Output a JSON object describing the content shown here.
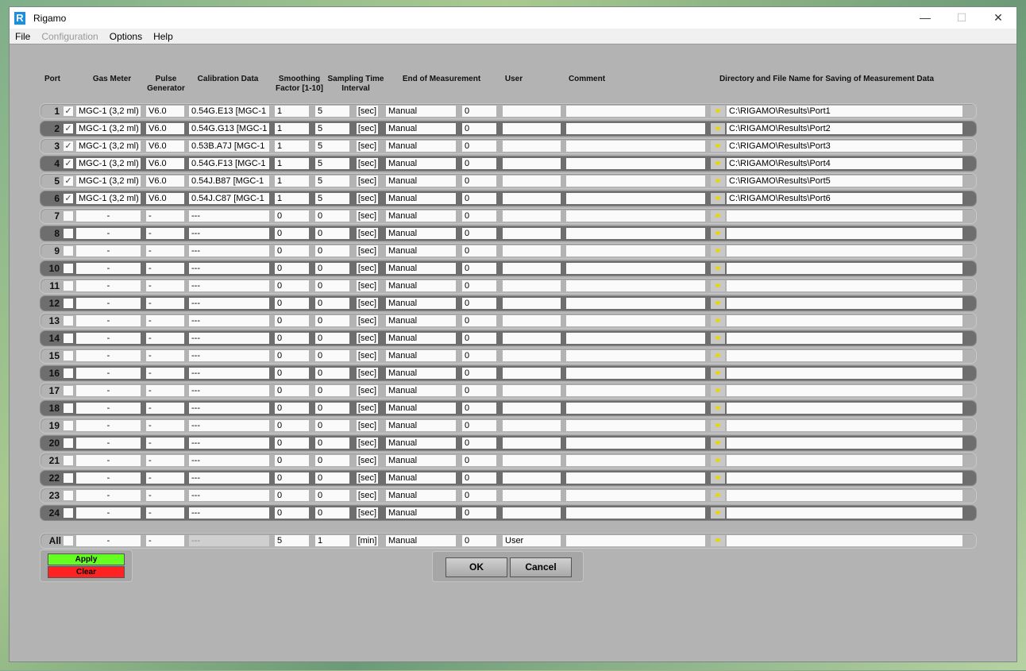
{
  "window": {
    "title": "Rigamo",
    "minimize": "—",
    "maximize": "☐",
    "close": "✕"
  },
  "menu": [
    "File",
    "Configuration",
    "Options",
    "Help"
  ],
  "headers": {
    "port": "Port",
    "gas_meter": "Gas Meter",
    "pulse": "Pulse Generator",
    "calibration": "Calibration Data",
    "smoothing": "Smoothing Factor [1-10]",
    "sampling": "Sampling Time Interval",
    "end": "End of Measurement",
    "user": "User",
    "comment": "Comment",
    "directory": "Directory and File Name for Saving of Measurement Data"
  },
  "rows": [
    {
      "port": "1",
      "checked": true,
      "gas": "MGC-1 (3,2 ml)",
      "pulse": "V6.0",
      "cal": "0.54G.E13 [MGC-1",
      "smooth": "1",
      "sample": "5",
      "unit": "[sec]",
      "end": "Manual",
      "end_val": "0",
      "user": "",
      "comment": "",
      "dir": "C:\\RIGAMO\\Results\\Port1"
    },
    {
      "port": "2",
      "checked": true,
      "gas": "MGC-1 (3,2 ml)",
      "pulse": "V6.0",
      "cal": "0.54G.G13 [MGC-1",
      "smooth": "1",
      "sample": "5",
      "unit": "[sec]",
      "end": "Manual",
      "end_val": "0",
      "user": "",
      "comment": "",
      "dir": "C:\\RIGAMO\\Results\\Port2"
    },
    {
      "port": "3",
      "checked": true,
      "gas": "MGC-1 (3,2 ml)",
      "pulse": "V6.0",
      "cal": "0.53B.A7J [MGC-1",
      "smooth": "1",
      "sample": "5",
      "unit": "[sec]",
      "end": "Manual",
      "end_val": "0",
      "user": "",
      "comment": "",
      "dir": "C:\\RIGAMO\\Results\\Port3"
    },
    {
      "port": "4",
      "checked": true,
      "gas": "MGC-1 (3,2 ml)",
      "pulse": "V6.0",
      "cal": "0.54G.F13 [MGC-1",
      "smooth": "1",
      "sample": "5",
      "unit": "[sec]",
      "end": "Manual",
      "end_val": "0",
      "user": "",
      "comment": "",
      "dir": "C:\\RIGAMO\\Results\\Port4"
    },
    {
      "port": "5",
      "checked": true,
      "gas": "MGC-1 (3,2 ml)",
      "pulse": "V6.0",
      "cal": "0.54J.B87 [MGC-1",
      "smooth": "1",
      "sample": "5",
      "unit": "[sec]",
      "end": "Manual",
      "end_val": "0",
      "user": "",
      "comment": "",
      "dir": "C:\\RIGAMO\\Results\\Port5"
    },
    {
      "port": "6",
      "checked": true,
      "gas": "MGC-1 (3,2 ml)",
      "pulse": "V6.0",
      "cal": "0.54J.C87 [MGC-1",
      "smooth": "1",
      "sample": "5",
      "unit": "[sec]",
      "end": "Manual",
      "end_val": "0",
      "user": "",
      "comment": "",
      "dir": "C:\\RIGAMO\\Results\\Port6"
    },
    {
      "port": "7",
      "checked": false,
      "gas": "-",
      "pulse": "-",
      "cal": "---",
      "smooth": "0",
      "sample": "0",
      "unit": "[sec]",
      "end": "Manual",
      "end_val": "0",
      "user": "",
      "comment": "",
      "dir": ""
    },
    {
      "port": "8",
      "checked": false,
      "gas": "-",
      "pulse": "-",
      "cal": "---",
      "smooth": "0",
      "sample": "0",
      "unit": "[sec]",
      "end": "Manual",
      "end_val": "0",
      "user": "",
      "comment": "",
      "dir": ""
    },
    {
      "port": "9",
      "checked": false,
      "gas": "-",
      "pulse": "-",
      "cal": "---",
      "smooth": "0",
      "sample": "0",
      "unit": "[sec]",
      "end": "Manual",
      "end_val": "0",
      "user": "",
      "comment": "",
      "dir": ""
    },
    {
      "port": "10",
      "checked": false,
      "gas": "-",
      "pulse": "-",
      "cal": "---",
      "smooth": "0",
      "sample": "0",
      "unit": "[sec]",
      "end": "Manual",
      "end_val": "0",
      "user": "",
      "comment": "",
      "dir": ""
    },
    {
      "port": "11",
      "checked": false,
      "gas": "-",
      "pulse": "-",
      "cal": "---",
      "smooth": "0",
      "sample": "0",
      "unit": "[sec]",
      "end": "Manual",
      "end_val": "0",
      "user": "",
      "comment": "",
      "dir": ""
    },
    {
      "port": "12",
      "checked": false,
      "gas": "-",
      "pulse": "-",
      "cal": "---",
      "smooth": "0",
      "sample": "0",
      "unit": "[sec]",
      "end": "Manual",
      "end_val": "0",
      "user": "",
      "comment": "",
      "dir": ""
    },
    {
      "port": "13",
      "checked": false,
      "gas": "-",
      "pulse": "-",
      "cal": "---",
      "smooth": "0",
      "sample": "0",
      "unit": "[sec]",
      "end": "Manual",
      "end_val": "0",
      "user": "",
      "comment": "",
      "dir": ""
    },
    {
      "port": "14",
      "checked": false,
      "gas": "-",
      "pulse": "-",
      "cal": "---",
      "smooth": "0",
      "sample": "0",
      "unit": "[sec]",
      "end": "Manual",
      "end_val": "0",
      "user": "",
      "comment": "",
      "dir": ""
    },
    {
      "port": "15",
      "checked": false,
      "gas": "-",
      "pulse": "-",
      "cal": "---",
      "smooth": "0",
      "sample": "0",
      "unit": "[sec]",
      "end": "Manual",
      "end_val": "0",
      "user": "",
      "comment": "",
      "dir": ""
    },
    {
      "port": "16",
      "checked": false,
      "gas": "-",
      "pulse": "-",
      "cal": "---",
      "smooth": "0",
      "sample": "0",
      "unit": "[sec]",
      "end": "Manual",
      "end_val": "0",
      "user": "",
      "comment": "",
      "dir": ""
    },
    {
      "port": "17",
      "checked": false,
      "gas": "-",
      "pulse": "-",
      "cal": "---",
      "smooth": "0",
      "sample": "0",
      "unit": "[sec]",
      "end": "Manual",
      "end_val": "0",
      "user": "",
      "comment": "",
      "dir": ""
    },
    {
      "port": "18",
      "checked": false,
      "gas": "-",
      "pulse": "-",
      "cal": "---",
      "smooth": "0",
      "sample": "0",
      "unit": "[sec]",
      "end": "Manual",
      "end_val": "0",
      "user": "",
      "comment": "",
      "dir": ""
    },
    {
      "port": "19",
      "checked": false,
      "gas": "-",
      "pulse": "-",
      "cal": "---",
      "smooth": "0",
      "sample": "0",
      "unit": "[sec]",
      "end": "Manual",
      "end_val": "0",
      "user": "",
      "comment": "",
      "dir": ""
    },
    {
      "port": "20",
      "checked": false,
      "gas": "-",
      "pulse": "-",
      "cal": "---",
      "smooth": "0",
      "sample": "0",
      "unit": "[sec]",
      "end": "Manual",
      "end_val": "0",
      "user": "",
      "comment": "",
      "dir": ""
    },
    {
      "port": "21",
      "checked": false,
      "gas": "-",
      "pulse": "-",
      "cal": "---",
      "smooth": "0",
      "sample": "0",
      "unit": "[sec]",
      "end": "Manual",
      "end_val": "0",
      "user": "",
      "comment": "",
      "dir": ""
    },
    {
      "port": "22",
      "checked": false,
      "gas": "-",
      "pulse": "-",
      "cal": "---",
      "smooth": "0",
      "sample": "0",
      "unit": "[sec]",
      "end": "Manual",
      "end_val": "0",
      "user": "",
      "comment": "",
      "dir": ""
    },
    {
      "port": "23",
      "checked": false,
      "gas": "-",
      "pulse": "-",
      "cal": "---",
      "smooth": "0",
      "sample": "0",
      "unit": "[sec]",
      "end": "Manual",
      "end_val": "0",
      "user": "",
      "comment": "",
      "dir": ""
    },
    {
      "port": "24",
      "checked": false,
      "gas": "-",
      "pulse": "-",
      "cal": "---",
      "smooth": "0",
      "sample": "0",
      "unit": "[sec]",
      "end": "Manual",
      "end_val": "0",
      "user": "",
      "comment": "",
      "dir": ""
    }
  ],
  "all_row": {
    "port": "All",
    "checked": false,
    "gas": "-",
    "pulse": "-",
    "cal": "---",
    "smooth": "5",
    "sample": "1",
    "unit": "[min]",
    "end": "Manual",
    "end_val": "0",
    "user": "User",
    "comment": "",
    "dir": ""
  },
  "buttons": {
    "apply": "Apply",
    "clear": "Clear",
    "ok": "OK",
    "cancel": "Cancel"
  },
  "colors": {
    "apply": "#66ff22",
    "clear": "#ff2222",
    "folder": "#e8d800"
  }
}
